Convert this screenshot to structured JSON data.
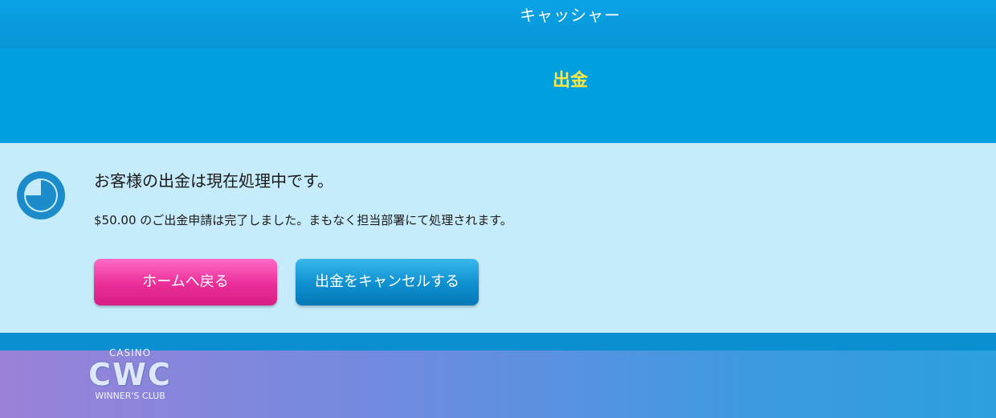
{
  "header": {
    "title": "キャッシャー",
    "section": "出金"
  },
  "status": {
    "icon": "clock-icon",
    "title": "お客様の出金は現在処理中です。",
    "detail": "$50.00 のご出金申請は完了しました。まもなく担当部署にて処理されます。"
  },
  "actions": {
    "home_label": "ホームへ戻る",
    "cancel_label": "出金をキャンセルする"
  },
  "logo": {
    "top": "CASINO",
    "main": "CWC",
    "bottom": "WINNER'S CLUB"
  },
  "colors": {
    "header": "#0894d6",
    "section_title": "#ffe640",
    "panel": "#c6ecfb",
    "home_button": "#ea2d98",
    "cancel_button": "#0e8fce"
  }
}
